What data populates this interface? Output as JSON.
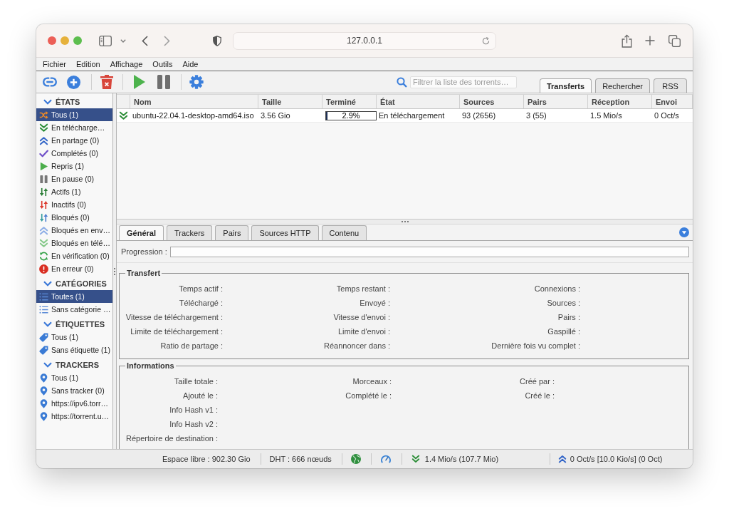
{
  "browser": {
    "address": "127.0.0.1"
  },
  "menu": [
    {
      "label": "Fichier"
    },
    {
      "label": "Edition"
    },
    {
      "label": "Affichage"
    },
    {
      "label": "Outils"
    },
    {
      "label": "Aide"
    }
  ],
  "toolbar": {
    "search": {
      "placeholder": "Filtrer la liste des torrents…"
    },
    "tabs": [
      {
        "label": "Transferts",
        "selected": true
      },
      {
        "label": "Rechercher",
        "selected": false
      },
      {
        "label": "RSS",
        "selected": false
      }
    ]
  },
  "sidebar": {
    "sections": [
      {
        "title": "ÉTATS",
        "expanded": true,
        "items": [
          {
            "kind": "all",
            "label": "Tous (1)",
            "selected": true
          },
          {
            "kind": "downloading",
            "label": "En télécharge…",
            "selected": false
          },
          {
            "kind": "seeding",
            "label": "En partage (0)",
            "selected": false
          },
          {
            "kind": "completed",
            "label": "Complétés (0)",
            "selected": false
          },
          {
            "kind": "resumed",
            "label": "Repris (1)",
            "selected": false
          },
          {
            "kind": "paused",
            "label": "En pause (0)",
            "selected": false
          },
          {
            "kind": "active",
            "label": "Actifs (1)",
            "selected": false
          },
          {
            "kind": "inactive",
            "label": "Inactifs (0)",
            "selected": false
          },
          {
            "kind": "stalled",
            "label": "Bloqués (0)",
            "selected": false
          },
          {
            "kind": "stalled_uploading",
            "label": "Bloqués en env…",
            "selected": false
          },
          {
            "kind": "stalled_downloading",
            "label": "Bloqués en télé…",
            "selected": false
          },
          {
            "kind": "checking",
            "label": "En vérification (0)",
            "selected": false
          },
          {
            "kind": "errored",
            "label": "En erreur (0)",
            "selected": false
          }
        ]
      },
      {
        "title": "CATÉGORIES",
        "expanded": true,
        "items": [
          {
            "kind": "category",
            "label": "Toutes (1)",
            "selected": true
          },
          {
            "kind": "category",
            "label": "Sans catégorie …",
            "selected": false
          }
        ]
      },
      {
        "title": "ÉTIQUETTES",
        "expanded": true,
        "items": [
          {
            "kind": "tag",
            "label": "Tous (1)",
            "selected": false
          },
          {
            "kind": "tag",
            "label": "Sans étiquette (1)",
            "selected": false
          }
        ]
      },
      {
        "title": "TRACKERS",
        "expanded": true,
        "items": [
          {
            "kind": "tracker",
            "label": "Tous (1)",
            "selected": false
          },
          {
            "kind": "tracker",
            "label": "Sans tracker (0)",
            "selected": false
          },
          {
            "kind": "tracker",
            "label": "https://ipv6.torr…",
            "selected": false
          },
          {
            "kind": "tracker",
            "label": "https://torrent.u…",
            "selected": false
          }
        ]
      }
    ]
  },
  "table": {
    "columns": [
      "Nom",
      "Taille",
      "Terminé",
      "État",
      "Sources",
      "Pairs",
      "Réception",
      "Envoi"
    ],
    "rows": [
      {
        "kind": "downloading",
        "selected": false,
        "name": "ubuntu-22.04.1-desktop-amd64.iso",
        "size": "3.56 Gio",
        "progress": {
          "level": 0.029,
          "text": "2.9%"
        },
        "state": "En téléchargement",
        "sources": "93 (2656)",
        "peers": "3 (55)",
        "download_speed": "1.5 Mio/s",
        "upload_speed": "0 Oct/s"
      }
    ]
  },
  "details": {
    "tabs": [
      {
        "label": "Général",
        "selected": true
      },
      {
        "label": "Trackers",
        "selected": false
      },
      {
        "label": "Pairs",
        "selected": false
      },
      {
        "label": "Sources HTTP",
        "selected": false
      },
      {
        "label": "Contenu",
        "selected": false
      }
    ],
    "progress": {
      "label": "Progression :",
      "level": 0
    },
    "groups": [
      {
        "title": "Transfert",
        "columns": [
          [
            "Temps actif :",
            "Téléchargé :",
            "Vitesse de téléchargement :",
            "Limite de téléchargement :",
            "Ratio de partage :"
          ],
          [
            "Temps restant :",
            "Envoyé :",
            "Vitesse d'envoi :",
            "Limite d'envoi :",
            "Réannoncer dans :"
          ],
          [
            "Connexions :",
            "Sources :",
            "Pairs :",
            "Gaspillé :",
            "Dernière fois vu complet :"
          ]
        ]
      },
      {
        "title": "Informations",
        "columns": [
          [
            "Taille totale :",
            "Ajouté le :",
            "Info Hash v1 :",
            "Info Hash v2 :",
            "Répertoire de destination :"
          ],
          [
            "Morceaux :",
            "Complété le :"
          ],
          [
            "Créé par :",
            "Créé le :"
          ]
        ]
      }
    ]
  },
  "status_bar": {
    "free_space": "Espace libre : 902.30 Gio",
    "dht": "DHT : 666 nœuds",
    "connected": true,
    "alternative_speed": false,
    "download": "1.4 Mio/s (107.7 Mio)",
    "upload": "0 Oct/s [10.0 Kio/s] (0 Oct)"
  }
}
